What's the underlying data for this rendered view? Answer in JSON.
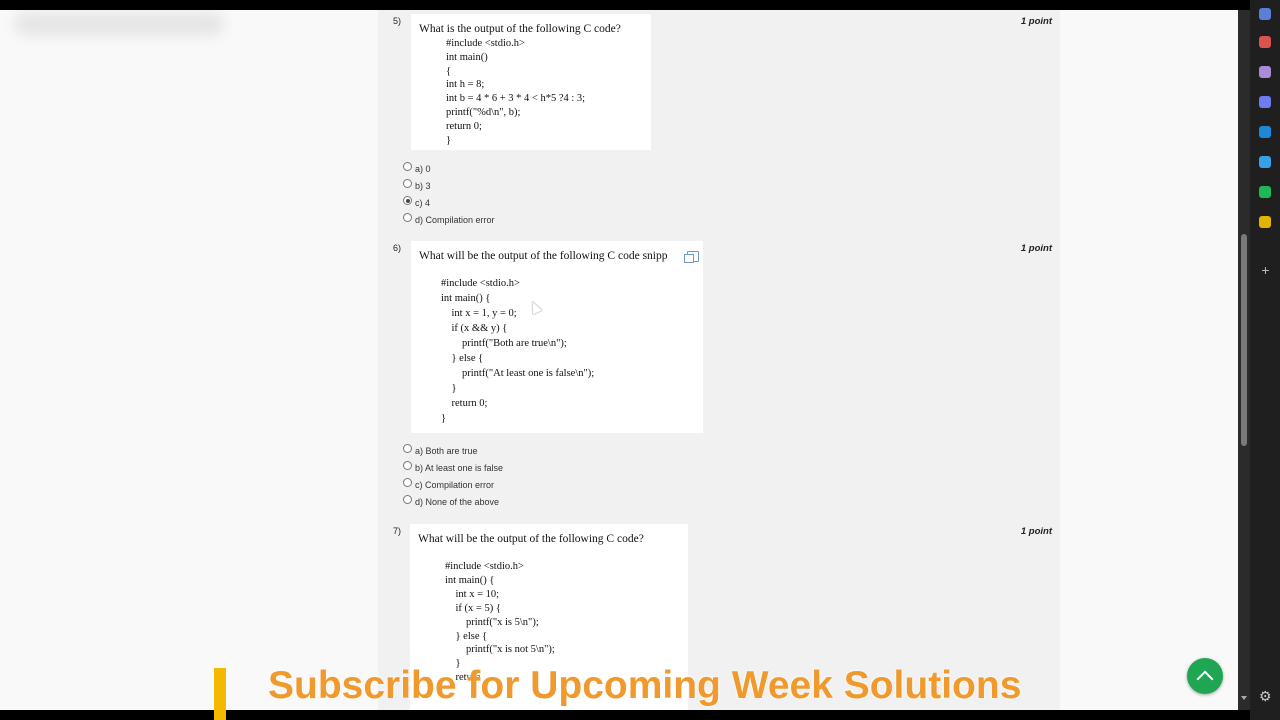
{
  "questions": [
    {
      "number": "5)",
      "points": "1 point",
      "question": "What is the output of the following C code?",
      "code": "#include <stdio.h>\nint main()\n{\nint h = 8;\nint b = 4 * 6 + 3 * 4 < h*5 ?4 : 3;\nprintf(\"%d\\n\", b);\nreturn 0;\n}",
      "options": [
        "a) 0",
        "b) 3",
        "c) 4",
        "d) Compilation error"
      ],
      "selected_index": 2
    },
    {
      "number": "6)",
      "points": "1 point",
      "question": "What will be the output of the following C code snipp",
      "code": "#include <stdio.h>\nint main() {\n    int x = 1, y = 0;\n    if (x && y) {\n        printf(\"Both are true\\n\");\n    } else {\n        printf(\"At least one is false\\n\");\n    }\n    return 0;\n}",
      "options": [
        "a) Both are true",
        "b) At least one is false",
        "c) Compilation error",
        "d) None of the above"
      ],
      "selected_index": -1
    },
    {
      "number": "7)",
      "points": "1 point",
      "question": "What will be the output of the following C code?",
      "code": "#include <stdio.h>\nint main() {\n    int x = 10;\n    if (x = 5) {\n        printf(\"x is 5\\n\");\n    } else {\n        printf(\"x is not 5\\n\");\n    }\n    return"
    }
  ],
  "banner": {
    "text": "Subscribe for Upcoming Week Solutions"
  },
  "sidebar_icons": [
    {
      "name": "favorites-icon",
      "color": "#5b7fd6"
    },
    {
      "name": "toolbox-icon",
      "color": "#d9534f"
    },
    {
      "name": "person-icon",
      "color": "#a98bd8"
    },
    {
      "name": "hexagon-icon",
      "color": "#6f7bf0"
    },
    {
      "name": "outlook-icon",
      "color": "#1e88d8"
    },
    {
      "name": "send-icon",
      "color": "#37a0e6"
    },
    {
      "name": "spotify-icon",
      "color": "#1db954"
    },
    {
      "name": "trophy-icon",
      "color": "#e0b400"
    }
  ],
  "colors": {
    "banner_text": "#f09a2e",
    "banner_bar": "#f5b800",
    "fab": "#1fa653"
  }
}
